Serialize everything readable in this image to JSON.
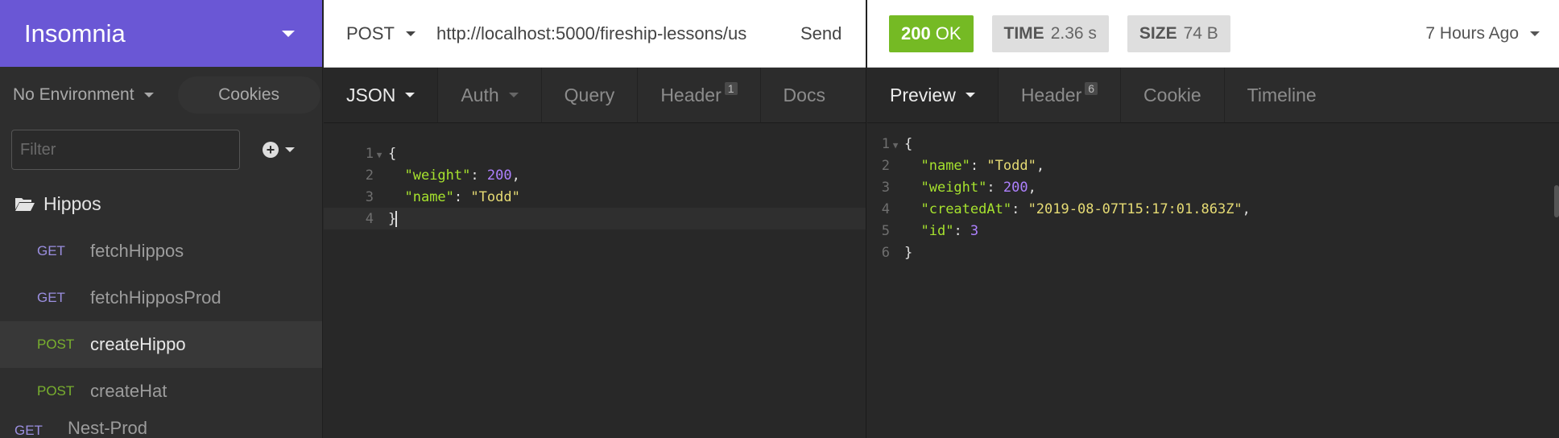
{
  "app": {
    "name": "Insomnia"
  },
  "environment": {
    "label": "No Environment",
    "cookies_label": "Cookies"
  },
  "filter": {
    "placeholder": "Filter"
  },
  "sidebar": {
    "folder": "Hippos",
    "requests": [
      {
        "method": "GET",
        "name": "fetchHippos"
      },
      {
        "method": "GET",
        "name": "fetchHipposProd"
      },
      {
        "method": "POST",
        "name": "createHippo"
      },
      {
        "method": "POST",
        "name": "createHat"
      },
      {
        "method": "GET",
        "name": "Nest-Prod"
      }
    ]
  },
  "request": {
    "method": "POST",
    "url": "http://localhost:5000/fireship-lessons/us",
    "send_label": "Send",
    "tabs": [
      {
        "label": "JSON"
      },
      {
        "label": "Auth"
      },
      {
        "label": "Query"
      },
      {
        "label": "Header",
        "badge": "1"
      },
      {
        "label": "Docs"
      }
    ],
    "body_lines": [
      {
        "num": "1",
        "text": "{"
      },
      {
        "num": "2",
        "text": "  \"weight\": 200,"
      },
      {
        "num": "3",
        "text": "  \"name\": \"Todd\""
      },
      {
        "num": "4",
        "text": "}"
      }
    ]
  },
  "response": {
    "status_code": "200",
    "status_text": "OK",
    "time_label": "TIME",
    "time_value": "2.36 s",
    "size_label": "SIZE",
    "size_value": "74 B",
    "time_ago": "7 Hours Ago",
    "tabs": [
      {
        "label": "Preview"
      },
      {
        "label": "Header",
        "badge": "6"
      },
      {
        "label": "Cookie"
      },
      {
        "label": "Timeline"
      }
    ],
    "body_lines": [
      {
        "num": "1",
        "text": "{"
      },
      {
        "num": "2",
        "text": "  \"name\": \"Todd\","
      },
      {
        "num": "3",
        "text": "  \"weight\": 200,"
      },
      {
        "num": "4",
        "text": "  \"createdAt\": \"2019-08-07T15:17:01.863Z\","
      },
      {
        "num": "5",
        "text": "  \"id\": 3"
      },
      {
        "num": "6",
        "text": "}"
      }
    ]
  },
  "colors": {
    "brand": "#6a57d5",
    "status_ok": "#75ba24",
    "method_get": "#9b8fe0",
    "method_post": "#79b02e",
    "json_key": "#a6e22e",
    "json_string": "#e6db74",
    "json_number": "#ae81ff"
  },
  "icons": {
    "folder": "folder-open-icon",
    "add": "plus-circle-icon",
    "caret": "caret-down-icon"
  }
}
